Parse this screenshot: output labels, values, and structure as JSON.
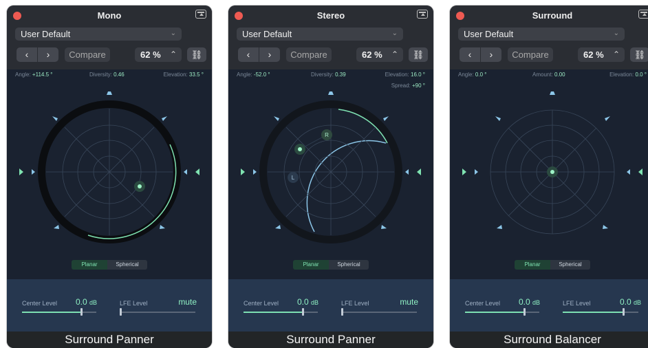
{
  "panels": [
    {
      "title": "Mono",
      "preset": "User Default",
      "compare": "Compare",
      "zoom": "62 %",
      "readouts": [
        {
          "label": "Angle:",
          "value": "+114.5 °"
        },
        {
          "label": "Diversity:",
          "value": "0.46"
        },
        {
          "label": "Elevation:",
          "value": "33.5 °"
        }
      ],
      "extra_readout": null,
      "modes": {
        "planar": "Planar",
        "spherical": "Spherical",
        "active": "planar"
      },
      "levels": {
        "center_label": "Center Level",
        "center_value": "0.0",
        "center_unit": "dB",
        "center_position": 0.8,
        "lfe_label": "LFE Level",
        "lfe_value": "mute",
        "lfe_position": 0.0
      },
      "caption": "Surround Panner"
    },
    {
      "title": "Stereo",
      "preset": "User Default",
      "compare": "Compare",
      "zoom": "62 %",
      "readouts": [
        {
          "label": "Angle:",
          "value": "-52.0 °"
        },
        {
          "label": "Diversity:",
          "value": "0.39"
        },
        {
          "label": "Elevation:",
          "value": "16.0 °"
        }
      ],
      "extra_readout": {
        "label": "Spread:",
        "value": "+90 °"
      },
      "modes": {
        "planar": "Planar",
        "spherical": "Spherical",
        "active": "planar"
      },
      "levels": {
        "center_label": "Center Level",
        "center_value": "0.0",
        "center_unit": "dB",
        "center_position": 0.8,
        "lfe_label": "LFE Level",
        "lfe_value": "mute",
        "lfe_position": 0.0
      },
      "caption": "Surround Panner"
    },
    {
      "title": "Surround",
      "preset": "User Default",
      "compare": "Compare",
      "zoom": "62 %",
      "readouts": [
        {
          "label": "Angle:",
          "value": "0.0 °"
        },
        {
          "label": "Amount:",
          "value": "0.00"
        },
        {
          "label": "Elevation:",
          "value": "0.0 °"
        }
      ],
      "extra_readout": null,
      "modes": {
        "planar": "Planar",
        "spherical": "Spherical",
        "active": "planar"
      },
      "levels": {
        "center_label": "Center Level",
        "center_value": "0.0",
        "center_unit": "dB",
        "center_position": 0.8,
        "lfe_label": "LFE Level",
        "lfe_value": "0.0",
        "lfe_unit": "dB",
        "lfe_position": 0.8
      },
      "caption": "Surround Balancer"
    }
  ],
  "puck_labels": {
    "left": "L",
    "right": "R"
  },
  "colors": {
    "accent_green": "#7fe3b1",
    "accent_blue": "#8cc6e8",
    "close_red": "#ee5a52",
    "panel_bg": "#1a2230"
  },
  "icons": {
    "prev": "chevron-left-icon",
    "next": "chevron-right-icon",
    "zoom_stepper": "stepper-icon",
    "link": "link-icon",
    "speaker": "speaker-icon",
    "expand": "expand-icon",
    "select": "chevron-down-icon"
  }
}
